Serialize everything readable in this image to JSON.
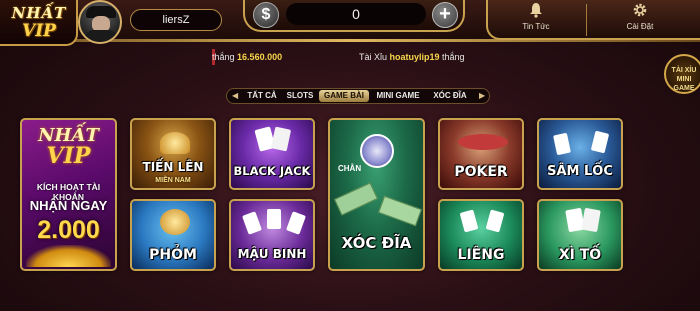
{
  "header": {
    "logo": {
      "line1": "NHẤT",
      "line2": "VIP"
    },
    "username": "liersZ",
    "balance": {
      "currency_symbol": "$",
      "value": "0",
      "add_symbol": "+"
    },
    "news_label": "Tin Tức",
    "settings_label": "Cài Đặt"
  },
  "ticker": {
    "text_win": "thắng",
    "amount": "16.560.000",
    "game": "Tài Xỉu",
    "user": "hoatuylip19",
    "text_win2": "thắng"
  },
  "mini_game_badge": {
    "line1": "TÀI XỈU",
    "line2": "MINI",
    "line3": "GAME"
  },
  "tabs": {
    "items": [
      "TẤT CẢ",
      "SLOTS",
      "GAME BÀI",
      "MINI GAME",
      "XÓC ĐĨA"
    ],
    "active": "GAME BÀI"
  },
  "promo": {
    "logo_line1": "NHẤT",
    "logo_line2": "VIP",
    "line1": "KÍCH HOẠT TÀI KHOẢN",
    "line2": "NHẬN NGAY",
    "line3": "2.000"
  },
  "games": {
    "tien_len": {
      "title": "TIẾN LÊN",
      "sub": "MIỀN NAM"
    },
    "black_jack": {
      "title": "BLACK JACK"
    },
    "xoc_dia": {
      "title": "XÓC ĐĨA",
      "chan": "CHẴN"
    },
    "poker": {
      "title": "POKER"
    },
    "sam_loc": {
      "title": "SÂM LỐC"
    },
    "phom": {
      "title": "PHỎM"
    },
    "mau_binh": {
      "title": "MẬU BINH"
    },
    "lieng": {
      "title": "LIÊNG"
    },
    "xi_to": {
      "title": "XÌ TỐ"
    }
  },
  "colors": {
    "gold": "#c9a24f",
    "accent_yellow": "#f7d64a",
    "background": "#2b1016"
  },
  "icons": [
    "bell-icon",
    "gear-icon",
    "dollar-icon",
    "plus-icon"
  ]
}
